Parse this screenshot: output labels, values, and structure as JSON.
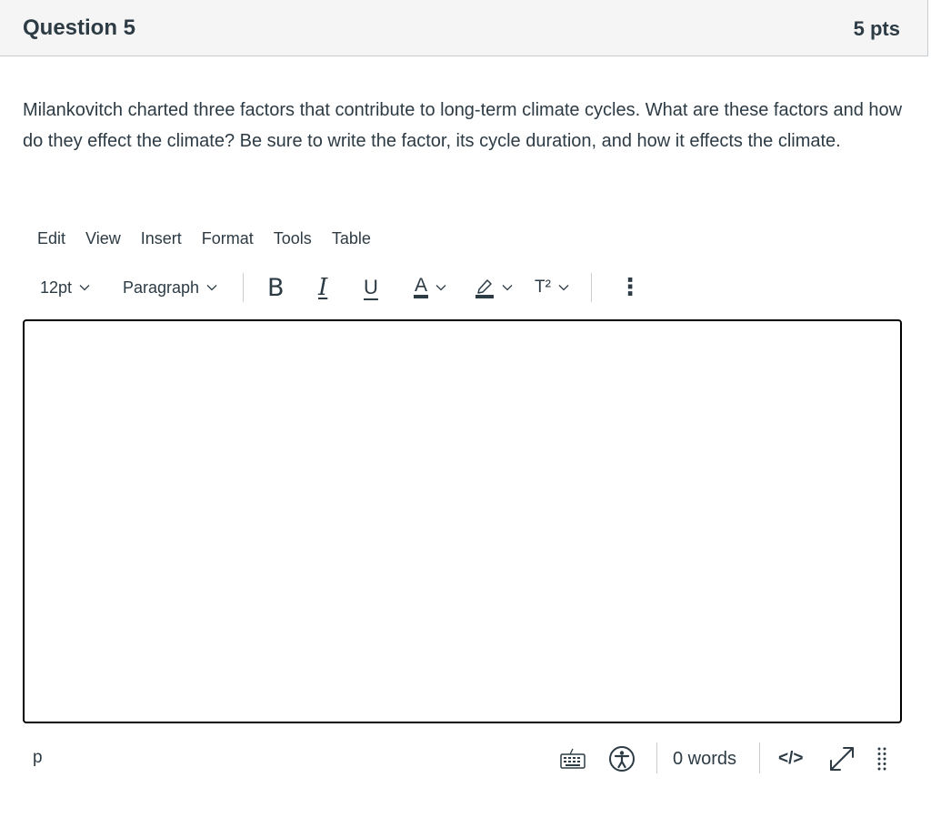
{
  "question": {
    "title": "Question 5",
    "points": "5 pts",
    "text": "Milankovitch charted three factors that contribute to long-term climate cycles. What are these factors and how do they effect the climate? Be sure to write the factor, its cycle duration, and how it effects the climate."
  },
  "editor": {
    "menu": [
      "Edit",
      "View",
      "Insert",
      "Format",
      "Tools",
      "Table"
    ],
    "toolbar": {
      "font_size": "12pt",
      "block_format": "Paragraph",
      "bold_label": "B",
      "italic_label": "I",
      "underline_label": "U",
      "text_color_label": "A",
      "superscript_label": "T²",
      "more_label": "⋮",
      "icons": [
        "chevron-down-icon",
        "highlighter-icon",
        "more-vertical-icon"
      ]
    },
    "content": "",
    "status": {
      "path": "p",
      "word_count": "0 words",
      "html_toggle_label": "</>",
      "icons": [
        "keyboard-icon",
        "accessibility-icon",
        "fullscreen-icon",
        "resize-grip-icon"
      ]
    }
  },
  "colors": {
    "text": "#2d3b45",
    "header_bg": "#f5f5f5",
    "border": "#c7cdd1",
    "editor_border": "#000000"
  }
}
